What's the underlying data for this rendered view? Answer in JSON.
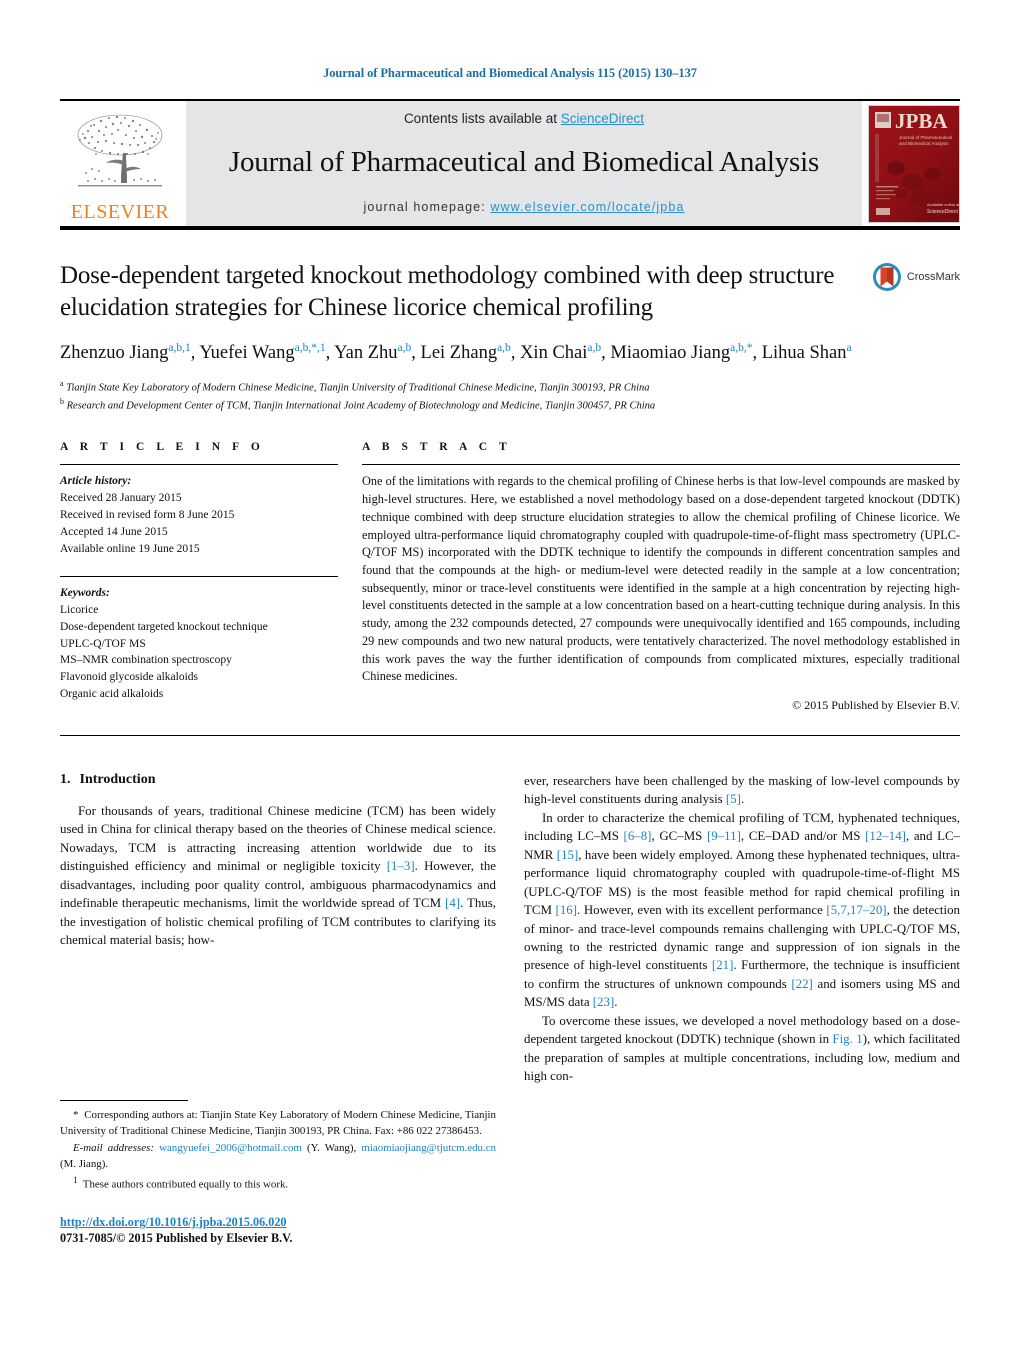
{
  "running_head": "Journal of Pharmaceutical and Biomedical Analysis 115 (2015) 130–137",
  "masthead": {
    "contents_prefix": "Contents lists available at ",
    "sciencedirect": "ScienceDirect",
    "journal_title": "Journal of Pharmaceutical and Biomedical Analysis",
    "homepage_label": "journal homepage: ",
    "homepage_url": "www.elsevier.com/locate/jpba",
    "publisher_logo_text": "ELSEVIER",
    "cover_title": "JPBA",
    "cover_subtitle": "Journal of Pharmaceutical and Biomedical Analysis",
    "colors": {
      "link": "#2a8fd0",
      "banner_bg": "#e4e5e7",
      "elsevier_orange": "#f08020",
      "cover_red": "#8d0f14"
    }
  },
  "article": {
    "title": "Dose-dependent targeted knockout methodology combined with deep structure elucidation strategies for Chinese licorice chemical profiling",
    "crossmark_label": "CrossMark",
    "authors_html": "Zhenzuo Jiang<sup>a,b,1</sup>, Yuefei Wang<sup>a,b,*,1</sup>, Yan Zhu<sup>a,b</sup>, Lei Zhang<sup>a,b</sup>, Xin Chai<sup>a,b</sup>, Miaomiao Jiang<sup>a,b,*</sup>, Lihua Shan<sup>a</sup>",
    "affiliations": [
      {
        "marker": "a",
        "text": "Tianjin State Key Laboratory of Modern Chinese Medicine, Tianjin University of Traditional Chinese Medicine, Tianjin 300193, PR China"
      },
      {
        "marker": "b",
        "text": "Research and Development Center of TCM, Tianjin International Joint Academy of Biotechnology and Medicine, Tianjin 300457, PR China"
      }
    ]
  },
  "article_info": {
    "heading": "A R T I C L E   I N F O",
    "history_label": "Article history:",
    "history": [
      "Received 28 January 2015",
      "Received in revised form 8 June 2015",
      "Accepted 14 June 2015",
      "Available online 19 June 2015"
    ],
    "keywords_label": "Keywords:",
    "keywords": [
      "Licorice",
      "Dose-dependent targeted knockout technique",
      "UPLC-Q/TOF MS",
      "MS–NMR combination spectroscopy",
      "Flavonoid glycoside alkaloids",
      "Organic acid alkaloids"
    ]
  },
  "abstract": {
    "heading": "A B S T R A C T",
    "text": "One of the limitations with regards to the chemical profiling of Chinese herbs is that low-level compounds are masked by high-level structures. Here, we established a novel methodology based on a dose-dependent targeted knockout (DDTK) technique combined with deep structure elucidation strategies to allow the chemical profiling of Chinese licorice. We employed ultra-performance liquid chromatography coupled with quadrupole-time-of-flight mass spectrometry (UPLC-Q/TOF MS) incorporated with the DDTK technique to identify the compounds in different concentration samples and found that the compounds at the high- or medium-level were detected readily in the sample at a low concentration; subsequently, minor or trace-level constituents were identified in the sample at a high concentration by rejecting high-level constituents detected in the sample at a low concentration based on a heart-cutting technique during analysis. In this study, among the 232 compounds detected, 27 compounds were unequivocally identified and 165 compounds, including 29 new compounds and two new natural products, were tentatively characterized. The novel methodology established in this work paves the way the further identification of compounds from complicated mixtures, especially traditional Chinese medicines.",
    "copyright": "© 2015 Published by Elsevier B.V."
  },
  "introduction": {
    "number": "1.",
    "heading": "Introduction",
    "left_paragraph_html": "For thousands of years, traditional Chinese medicine (TCM) has been widely used in China for clinical therapy based on the theories of Chinese medical science. Nowadays, TCM is attracting increasing attention worldwide due to its distinguished efficiency and minimal or negligible toxicity <span class=\"ref\">[1–3]</span>. However, the disadvantages, including poor quality control, ambiguous pharmacodynamics and indefinable therapeutic mechanisms, limit the worldwide spread of TCM <span class=\"ref\">[4]</span>. Thus, the investigation of holistic chemical profiling of TCM contributes to clarifying its chemical material basis; how-",
    "right_paragraph_1_html": "ever, researchers have been challenged by the masking of low-level compounds by high-level constituents during analysis <span class=\"ref\">[5]</span>.",
    "right_paragraph_2_html": "In order to characterize the chemical profiling of TCM, hyphenated techniques, including LC–MS <span class=\"ref\">[6–8]</span>, GC–MS <span class=\"ref\">[9–11]</span>, CE–DAD and/or MS <span class=\"ref\">[12–14]</span>, and LC–NMR <span class=\"ref\">[15]</span>, have been widely employed. Among these hyphenated techniques, ultra-performance liquid chromatography coupled with quadrupole-time-of-flight MS (UPLC-Q/TOF MS) is the most feasible method for rapid chemical profiling in TCM <span class=\"ref\">[16]</span>. However, even with its excellent performance <span class=\"ref\">[5,7,17–20]</span>, the detection of minor- and trace-level compounds remains challenging with UPLC-Q/TOF MS, owning to the restricted dynamic range and suppression of ion signals in the presence of high-level constituents <span class=\"ref\">[21]</span>. Furthermore, the technique is insufficient to confirm the structures of unknown compounds <span class=\"ref\">[22]</span> and isomers using MS and MS/MS data <span class=\"ref\">[23]</span>.",
    "right_paragraph_3_html": "To overcome these issues, we developed a novel methodology based on a dose-dependent targeted knockout (DDTK) technique (shown in <span class=\"ref\">Fig. 1</span>), which facilitated the preparation of samples at multiple concentrations, including low, medium and high con-"
  },
  "footnotes": {
    "corresponding_html": "<span class=\"star\">*</span>&nbsp; Corresponding authors at: Tianjin State Key Laboratory of Modern Chinese Medicine, Tianjin University of Traditional Chinese Medicine, Tianjin 300193, PR China. Fax: +86 022 27386453.",
    "email_html": "<em>E-mail addresses:</em> <span class=\"mail\">wangyuefei_2006@hotmail.com</span> (Y. Wang), <span class=\"mail\">miaomiaojiang@tjutcm.edu.cn</span> (M. Jiang).",
    "equal_html": "<sup>1</sup>&nbsp; These authors contributed equally to this work."
  },
  "footer": {
    "doi": "http://dx.doi.org/10.1016/j.jpba.2015.06.020",
    "issn_line": "0731-7085/© 2015 Published by Elsevier B.V."
  }
}
